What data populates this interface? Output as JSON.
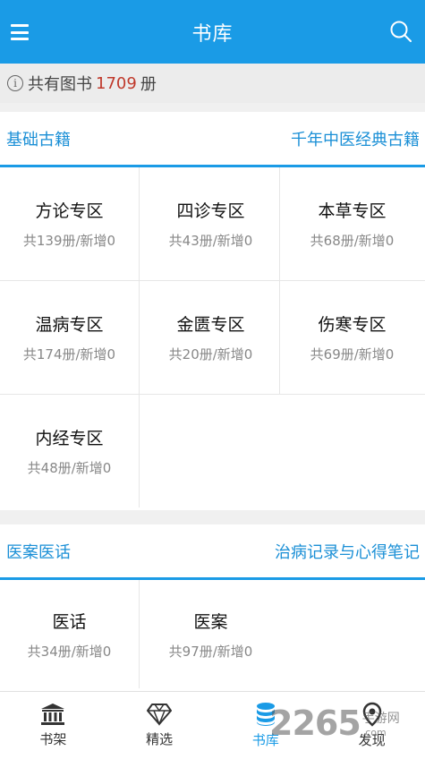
{
  "header": {
    "title": "书库",
    "menu_icon": "menu-icon",
    "search_icon": "search-icon"
  },
  "summary": {
    "prefix": "共有图书",
    "count": "1709",
    "suffix": "册"
  },
  "sections": [
    {
      "title": "基础古籍",
      "subtitle": "千年中医经典古籍",
      "items": [
        {
          "name": "方论专区",
          "stats": "共139册/新增0"
        },
        {
          "name": "四诊专区",
          "stats": "共43册/新增0"
        },
        {
          "name": "本草专区",
          "stats": "共68册/新增0"
        },
        {
          "name": "温病专区",
          "stats": "共174册/新增0"
        },
        {
          "name": "金匮专区",
          "stats": "共20册/新增0"
        },
        {
          "name": "伤寒专区",
          "stats": "共69册/新增0"
        },
        {
          "name": "内经专区",
          "stats": "共48册/新增0"
        }
      ]
    },
    {
      "title": "医案医话",
      "subtitle": "治病记录与心得笔记",
      "items": [
        {
          "name": "医话",
          "stats": "共34册/新增0"
        },
        {
          "name": "医案",
          "stats": "共97册/新增0"
        }
      ]
    }
  ],
  "tabbar": {
    "tabs": [
      {
        "label": "书架",
        "icon": "bank-icon"
      },
      {
        "label": "精选",
        "icon": "diamond-icon"
      },
      {
        "label": "书库",
        "icon": "database-icon",
        "active": true
      },
      {
        "label": "发现",
        "icon": "location-icon"
      }
    ]
  },
  "watermark": {
    "number": "2265",
    "site_cn": "手游网",
    "site_url": ".com"
  },
  "colors": {
    "primary": "#1a9be6",
    "count_red": "#c0392b"
  }
}
